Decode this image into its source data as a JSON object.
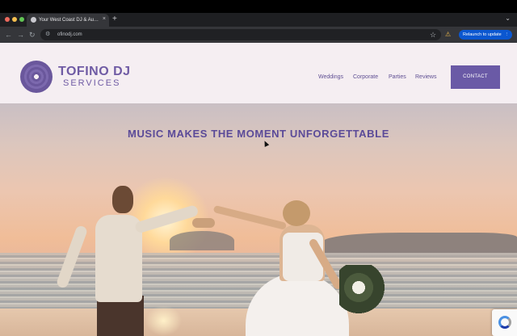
{
  "browser": {
    "tab_title": "Your West Coast DJ & Audio",
    "tab_close": "×",
    "new_tab": "+",
    "url": "ofinodj.com",
    "update_label": "Relaunch to update",
    "update_more": "⋮",
    "back": "←",
    "forward": "→",
    "reload": "↻",
    "site_info": "⚙",
    "star": "☆",
    "warning": "⚠",
    "tab_chevron": "⌄",
    "traffic_lights": [
      "#ed6a5e",
      "#f5bf4f",
      "#61c554"
    ]
  },
  "site": {
    "logo_line1": "TOFINO DJ",
    "logo_line2": "SERVICES",
    "nav": [
      "Weddings",
      "Corporate",
      "Parties",
      "Reviews"
    ],
    "contact_label": "CONTACT",
    "hero_title": "MUSIC MAKES THE MOMENT UNFORGETTABLE",
    "colors": {
      "brand": "#6a5aa6",
      "header_bg": "#f5eef2"
    }
  },
  "icons": {
    "logo": "vinyl-record-icon",
    "recaptcha": "recaptcha-icon",
    "cursor": "mouse-pointer-icon"
  }
}
